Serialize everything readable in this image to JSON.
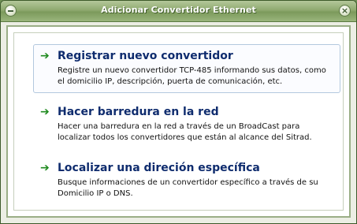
{
  "window": {
    "title": "Adicionar Convertidor Ethernet",
    "menu_icon": "minus-icon",
    "close_icon": "close-icon",
    "close_glyph": "×"
  },
  "options": [
    {
      "arrow": "➔",
      "title": "Registrar nuevo convertidor",
      "description": "Registre un nuevo convertidor TCP-485 informando sus datos, como el domicilio IP, descripción, puerta de comunicación, etc.",
      "selected": true
    },
    {
      "arrow": "➔",
      "title": "Hacer barredura en la red",
      "description": "Hacer una barredura en la red a través de un BroadCast para localizar todos los convertidores que están al alcance del Sitrad.",
      "selected": false
    },
    {
      "arrow": "➔",
      "title": "Localizar una direción específica",
      "description": "Busque informaciones de un convertidor específico a través de su Domicilio IP o DNS.",
      "selected": false
    }
  ],
  "colors": {
    "title_bar": "#8faa70",
    "option_title": "#0f2c6e",
    "arrow": "#1f8a1f",
    "selected_border": "#b3c8de"
  }
}
